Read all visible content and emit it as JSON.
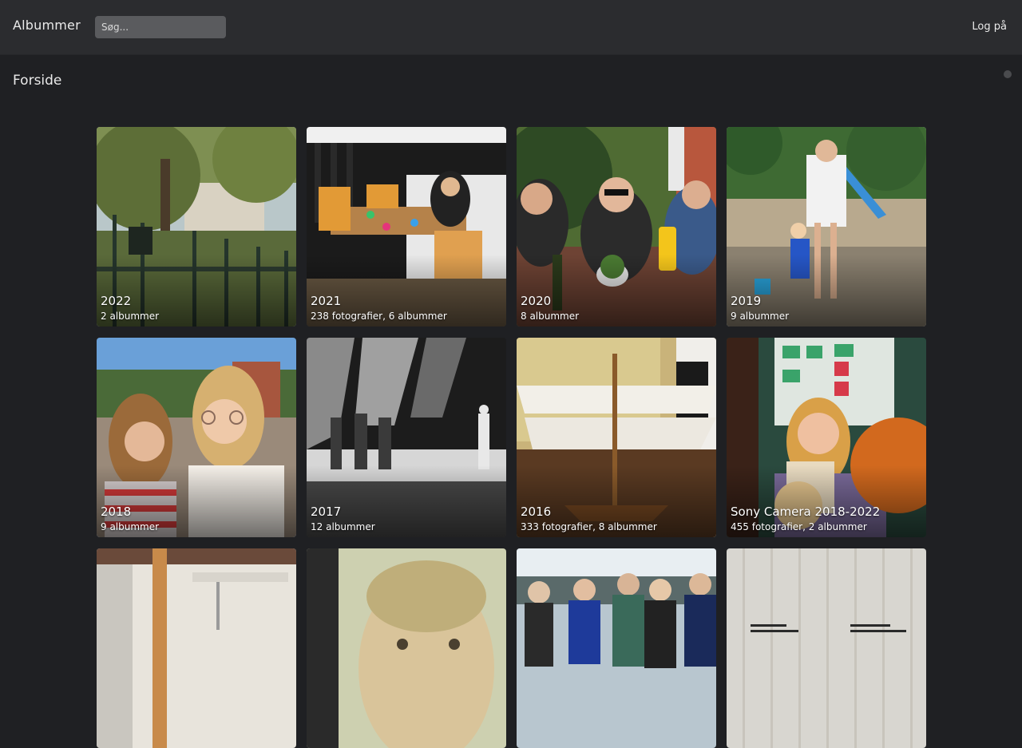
{
  "header": {
    "brand": "Albummer",
    "search_placeholder": "Søg...",
    "login": "Log på"
  },
  "page": {
    "title": "Forside"
  },
  "albums": [
    {
      "title": "2022",
      "meta": "2 albummer",
      "thumb": "garden-fence-icon"
    },
    {
      "title": "2021",
      "meta": "238 fotografier, 6 albummer",
      "thumb": "terrace-table-icon"
    },
    {
      "title": "2020",
      "meta": "8 albummer",
      "thumb": "dinner-people-icon"
    },
    {
      "title": "2019",
      "meta": "9 albummer",
      "thumb": "beach-lake-icon"
    },
    {
      "title": "2018",
      "meta": "9 albummer",
      "thumb": "girls-portrait-icon"
    },
    {
      "title": "2017",
      "meta": "12 albummer",
      "thumb": "stage-performance-icon"
    },
    {
      "title": "2016",
      "meta": "333 fotografier, 8 albummer",
      "thumb": "wooden-model-icon"
    },
    {
      "title": "Sony Camera 2018-2022",
      "meta": "455 fotografier, 2 albummer",
      "thumb": "woman-reading-icon"
    },
    {
      "title": "",
      "meta": "",
      "thumb": "interior-room-icon"
    },
    {
      "title": "",
      "meta": "",
      "thumb": "baby-face-icon"
    },
    {
      "title": "",
      "meta": "",
      "thumb": "group-photo-icon"
    },
    {
      "title": "",
      "meta": "",
      "thumb": "wood-wall-sign-icon"
    }
  ]
}
